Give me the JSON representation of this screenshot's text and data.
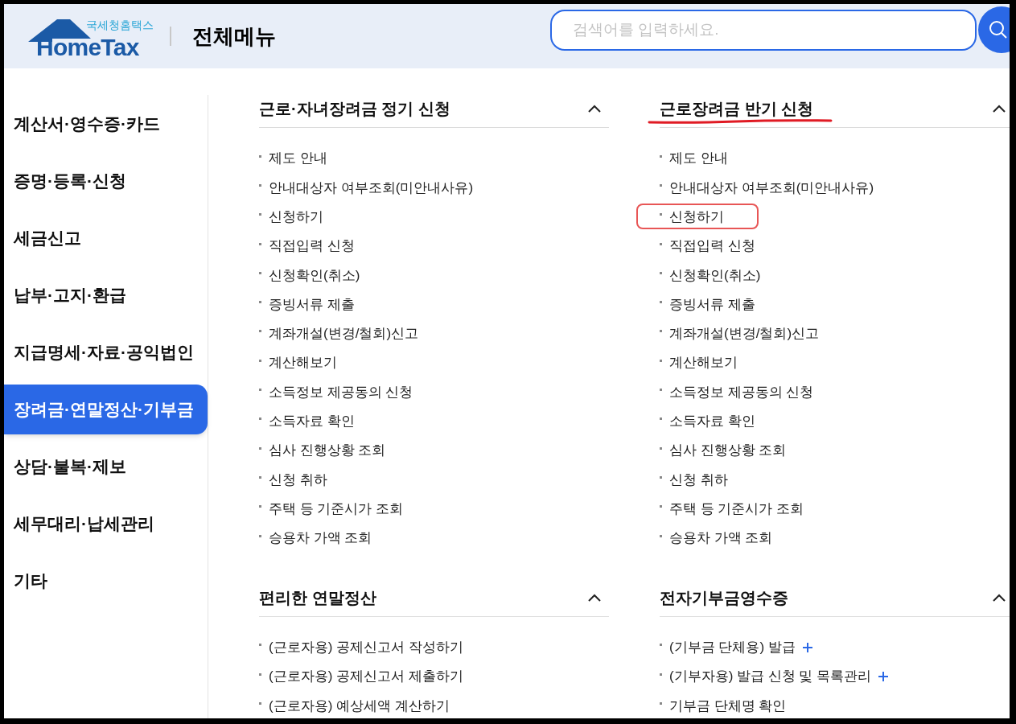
{
  "header": {
    "logo": {
      "subtitle": "국세청홈택스",
      "name": "HomeTax"
    },
    "title": "전체메뉴",
    "search": {
      "placeholder": "검색어를 입력하세요."
    }
  },
  "sidebar": {
    "items": [
      {
        "label": "계산서·영수증·카드",
        "selected": false
      },
      {
        "label": "증명·등록·신청",
        "selected": false
      },
      {
        "label": "세금신고",
        "selected": false
      },
      {
        "label": "납부·고지·환급",
        "selected": false
      },
      {
        "label": "지급명세·자료·공익법인",
        "selected": false
      },
      {
        "label": "장려금·연말정산·기부금",
        "selected": true
      },
      {
        "label": "상담·불복·제보",
        "selected": false
      },
      {
        "label": "세무대리·납세관리",
        "selected": false
      },
      {
        "label": "기타",
        "selected": false
      }
    ]
  },
  "sections": [
    {
      "title": "근로·자녀장려금 정기 신청",
      "expanded": true,
      "underlined": false,
      "items": [
        {
          "label": "제도 안내",
          "highlighted": false,
          "plus": false
        },
        {
          "label": "안내대상자 여부조회(미안내사유)",
          "highlighted": false,
          "plus": false
        },
        {
          "label": "신청하기",
          "highlighted": false,
          "plus": false
        },
        {
          "label": "직접입력 신청",
          "highlighted": false,
          "plus": false
        },
        {
          "label": "신청확인(취소)",
          "highlighted": false,
          "plus": false
        },
        {
          "label": "증빙서류 제출",
          "highlighted": false,
          "plus": false
        },
        {
          "label": "계좌개설(변경/철회)신고",
          "highlighted": false,
          "plus": false
        },
        {
          "label": "계산해보기",
          "highlighted": false,
          "plus": false
        },
        {
          "label": "소득정보 제공동의 신청",
          "highlighted": false,
          "plus": false
        },
        {
          "label": "소득자료 확인",
          "highlighted": false,
          "plus": false
        },
        {
          "label": "심사 진행상황 조회",
          "highlighted": false,
          "plus": false
        },
        {
          "label": "신청 취하",
          "highlighted": false,
          "plus": false
        },
        {
          "label": "주택 등 기준시가 조회",
          "highlighted": false,
          "plus": false
        },
        {
          "label": "승용차 가액 조회",
          "highlighted": false,
          "plus": false
        }
      ]
    },
    {
      "title": "근로장려금 반기 신청",
      "expanded": true,
      "underlined": true,
      "items": [
        {
          "label": "제도 안내",
          "highlighted": false,
          "plus": false
        },
        {
          "label": "안내대상자 여부조회(미안내사유)",
          "highlighted": false,
          "plus": false
        },
        {
          "label": "신청하기",
          "highlighted": true,
          "plus": false
        },
        {
          "label": "직접입력 신청",
          "highlighted": false,
          "plus": false
        },
        {
          "label": "신청확인(취소)",
          "highlighted": false,
          "plus": false
        },
        {
          "label": "증빙서류 제출",
          "highlighted": false,
          "plus": false
        },
        {
          "label": "계좌개설(변경/철회)신고",
          "highlighted": false,
          "plus": false
        },
        {
          "label": "계산해보기",
          "highlighted": false,
          "plus": false
        },
        {
          "label": "소득정보 제공동의 신청",
          "highlighted": false,
          "plus": false
        },
        {
          "label": "소득자료 확인",
          "highlighted": false,
          "plus": false
        },
        {
          "label": "심사 진행상황 조회",
          "highlighted": false,
          "plus": false
        },
        {
          "label": "신청 취하",
          "highlighted": false,
          "plus": false
        },
        {
          "label": "주택 등 기준시가 조회",
          "highlighted": false,
          "plus": false
        },
        {
          "label": "승용차 가액 조회",
          "highlighted": false,
          "plus": false
        }
      ]
    },
    {
      "title": "편리한 연말정산",
      "expanded": true,
      "underlined": false,
      "items": [
        {
          "label": "(근로자용) 공제신고서 작성하기",
          "highlighted": false,
          "plus": false
        },
        {
          "label": "(근로자용) 공제신고서 제출하기",
          "highlighted": false,
          "plus": false
        },
        {
          "label": "(근로자용) 예상세액 계산하기",
          "highlighted": false,
          "plus": false
        }
      ]
    },
    {
      "title": "전자기부금영수증",
      "expanded": true,
      "underlined": false,
      "items": [
        {
          "label": "(기부금 단체용) 발급",
          "highlighted": false,
          "plus": true
        },
        {
          "label": "(기부자용) 발급 신청 및 목록관리",
          "highlighted": false,
          "plus": true
        },
        {
          "label": "기부금 단체명 확인",
          "highlighted": false,
          "plus": false
        }
      ]
    }
  ]
}
